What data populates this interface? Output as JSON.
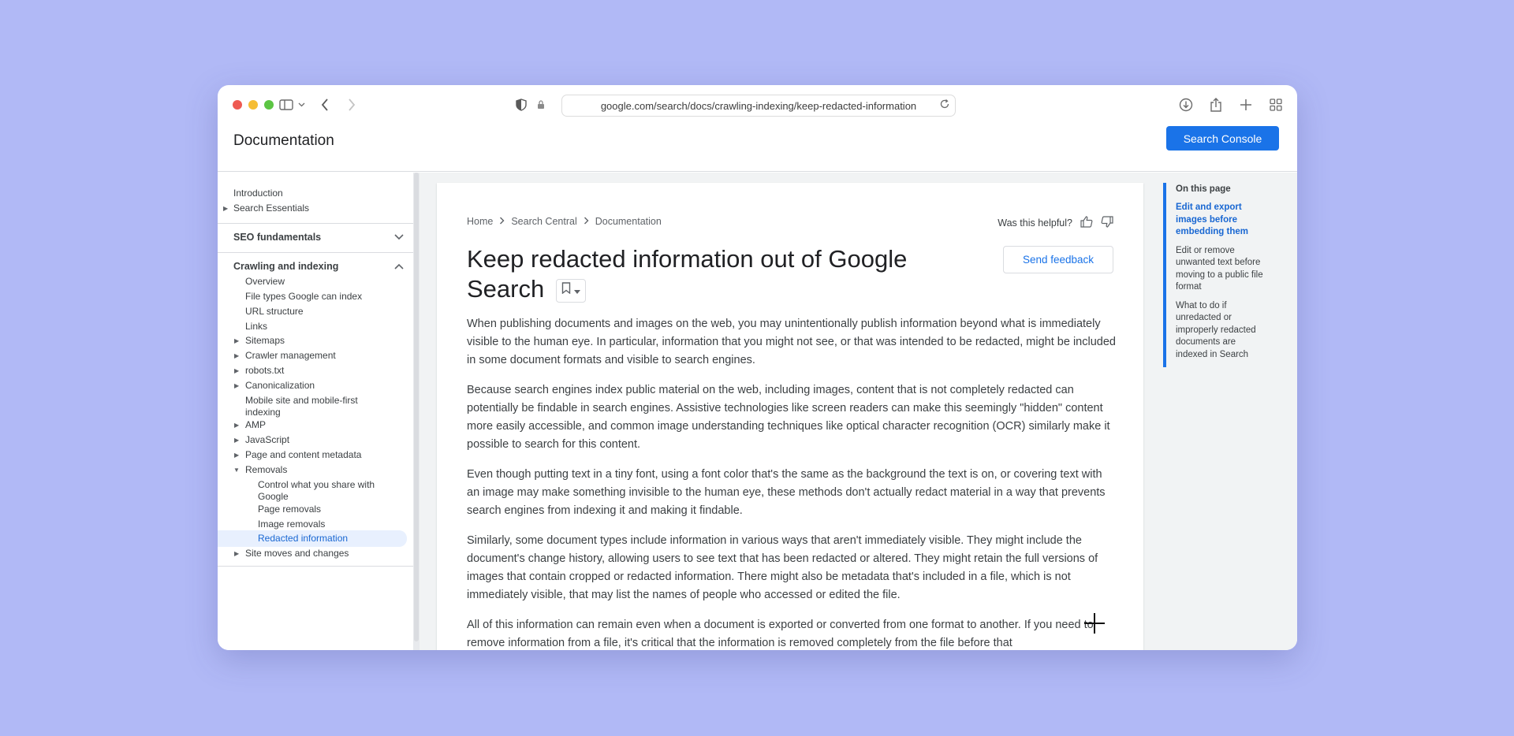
{
  "browser": {
    "url": "google.com/search/docs/crawling-indexing/keep-redacted-information"
  },
  "site": {
    "title": "Documentation",
    "console_button": "Search Console"
  },
  "nav": {
    "intro": "Introduction",
    "search_essentials": "Search Essentials",
    "seo_fundamentals": "SEO fundamentals",
    "crawling_indexing": "Crawling and indexing",
    "items": {
      "overview": "Overview",
      "file_types": "File types Google can index",
      "url_structure": "URL structure",
      "links": "Links",
      "sitemaps": "Sitemaps",
      "crawler_management": "Crawler management",
      "robots": "robots.txt",
      "canonicalization": "Canonicalization",
      "mobile_line1": "Mobile site and mobile-first",
      "mobile_line2": "indexing",
      "amp": "AMP",
      "javascript": "JavaScript",
      "page_metadata": "Page and content metadata",
      "removals": "Removals",
      "control_line1": "Control what you share with",
      "control_line2": "Google",
      "page_removals": "Page removals",
      "image_removals": "Image removals",
      "redacted": "Redacted information",
      "site_moves": "Site moves and changes"
    }
  },
  "article": {
    "breadcrumb": [
      "Home",
      "Search Central",
      "Documentation"
    ],
    "helpful_label": "Was this helpful?",
    "title_line1": "Keep redacted information out of Google",
    "title_line2": "Search",
    "feedback_button": "Send feedback",
    "paragraphs": [
      "When publishing documents and images on the web, you may unintentionally publish information beyond what is immediately visible to the human eye. In particular, information that you might not see, or that was intended to be redacted, might be included in some document formats and visible to search engines.",
      "Because search engines index public material on the web, including images, content that is not completely redacted can potentially be findable in search engines. Assistive technologies like screen readers can make this seemingly \"hidden\" content more easily accessible, and common image understanding techniques like optical character recognition (OCR) similarly make it possible to search for this content.",
      "Even though putting text in a tiny font, using a font color that's the same as the background the text is on, or covering text with an image may make something invisible to the human eye, these methods don't actually redact material in a way that prevents search engines from indexing it and making it findable.",
      "Similarly, some document types include information in various ways that aren't immediately visible. They might include the document's change history, allowing users to see text that has been redacted or altered. They might retain the full versions of images that contain cropped or redacted information. There might also be metadata that's included in a file, which is not immediately visible, that may list the names of people who accessed or edited the file.",
      "All of this information can remain even when a document is exported or converted from one format to another. If you need to remove information from a file, it's critical that the information is removed completely from the file before that"
    ]
  },
  "toc": {
    "heading": "On this page",
    "items": [
      "Edit and export images before embedding them",
      "Edit or remove unwanted text before moving to a public file format",
      "What to do if unredacted or improperly redacted documents are indexed in Search"
    ]
  },
  "colors": {
    "background": "#b1b9f6",
    "accent": "#1a73e8",
    "active_nav_bg": "#e8f0fe"
  }
}
